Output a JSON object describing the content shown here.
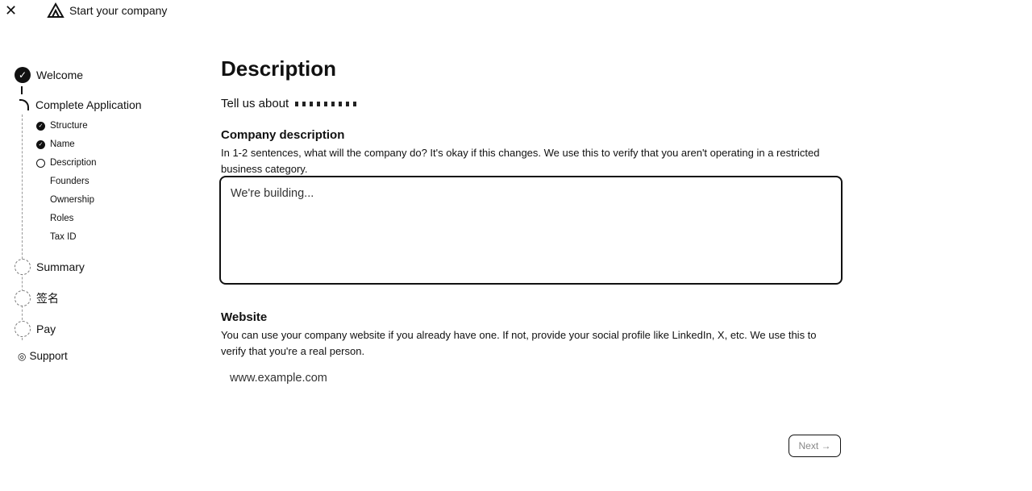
{
  "window": {
    "close_icon": "close-icon",
    "logo_icon": "stripe-atlas-logo",
    "title": "Start your company"
  },
  "sidebar": {
    "steps": [
      {
        "label": "Welcome",
        "state": "done"
      },
      {
        "label": "Complete Application",
        "state": "current"
      },
      {
        "label": "Summary",
        "state": "pending"
      },
      {
        "label": "签名",
        "state": "pending"
      },
      {
        "label": "Pay",
        "state": "pending"
      }
    ],
    "substeps": [
      {
        "label": "Structure",
        "state": "done"
      },
      {
        "label": "Name",
        "state": "done"
      },
      {
        "label": "Description",
        "state": "current"
      },
      {
        "label": "Founders",
        "state": "pending"
      },
      {
        "label": "Ownership",
        "state": "pending"
      },
      {
        "label": "Roles",
        "state": "pending"
      },
      {
        "label": "Tax ID",
        "state": "pending"
      }
    ],
    "support_label": "Support"
  },
  "main": {
    "title": "Description",
    "intro": "Tell us about",
    "company_description": {
      "title": "Company description",
      "help": "In 1-2 sentences, what will the company do? It's okay if this changes. We use this to verify that you aren't operating in a restricted business category.",
      "placeholder": "We're building..."
    },
    "website": {
      "title": "Website",
      "help": "You can use your company website if you already have one. If not, provide your social profile like LinkedIn, X, etc. We use this to verify that you're a real person.",
      "placeholder": "www.example.com"
    },
    "next_label": "Next →"
  }
}
